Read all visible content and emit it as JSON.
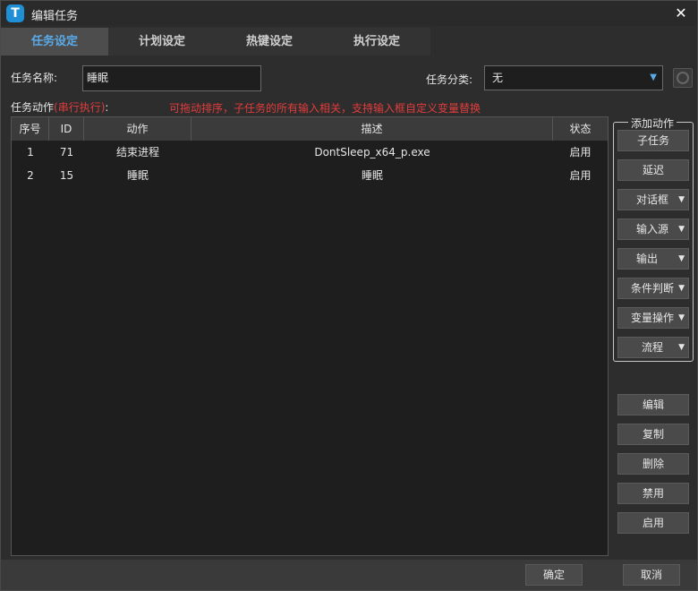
{
  "window": {
    "title": "编辑任务",
    "app_icon_letter": "T",
    "close_glyph": "✕"
  },
  "tabs": [
    {
      "label": "任务设定",
      "active": true
    },
    {
      "label": "计划设定",
      "active": false
    },
    {
      "label": "热键设定",
      "active": false
    },
    {
      "label": "执行设定",
      "active": false
    }
  ],
  "form": {
    "name_label": "任务名称:",
    "name_value": "睡眠",
    "category_label": "任务分类:",
    "category_value": "无"
  },
  "actions_section": {
    "label": "任务动作",
    "mode": "(串行执行)",
    "colon": ":",
    "hint": "可拖动排序，子任务的所有输入相关，支持输入框自定义变量替换"
  },
  "table": {
    "columns": [
      "序号",
      "ID",
      "动作",
      "描述",
      "状态"
    ],
    "rows": [
      {
        "index": "1",
        "id": "71",
        "action": "结束进程",
        "description": "DontSleep_x64_p.exe",
        "status": "启用"
      },
      {
        "index": "2",
        "id": "15",
        "action": "睡眠",
        "description": "睡眠",
        "status": "启用"
      }
    ]
  },
  "add_actions": {
    "title": "添加动作",
    "buttons": [
      {
        "label": "子任务",
        "dropdown": false
      },
      {
        "label": "延迟",
        "dropdown": false
      },
      {
        "label": "对话框",
        "dropdown": true
      },
      {
        "label": "输入源",
        "dropdown": true
      },
      {
        "label": "输出",
        "dropdown": true
      },
      {
        "label": "条件判断",
        "dropdown": true
      },
      {
        "label": "变量操作",
        "dropdown": true
      },
      {
        "label": "流程",
        "dropdown": true
      }
    ]
  },
  "edit_actions": [
    "编辑",
    "复制",
    "删除",
    "禁用",
    "启用"
  ],
  "footer": {
    "ok_label": "确定",
    "cancel_label": "取消"
  },
  "colors": {
    "accent": "#5aaae8",
    "hint_red": "#e23c3c",
    "app_icon": "#1f8fd6"
  }
}
